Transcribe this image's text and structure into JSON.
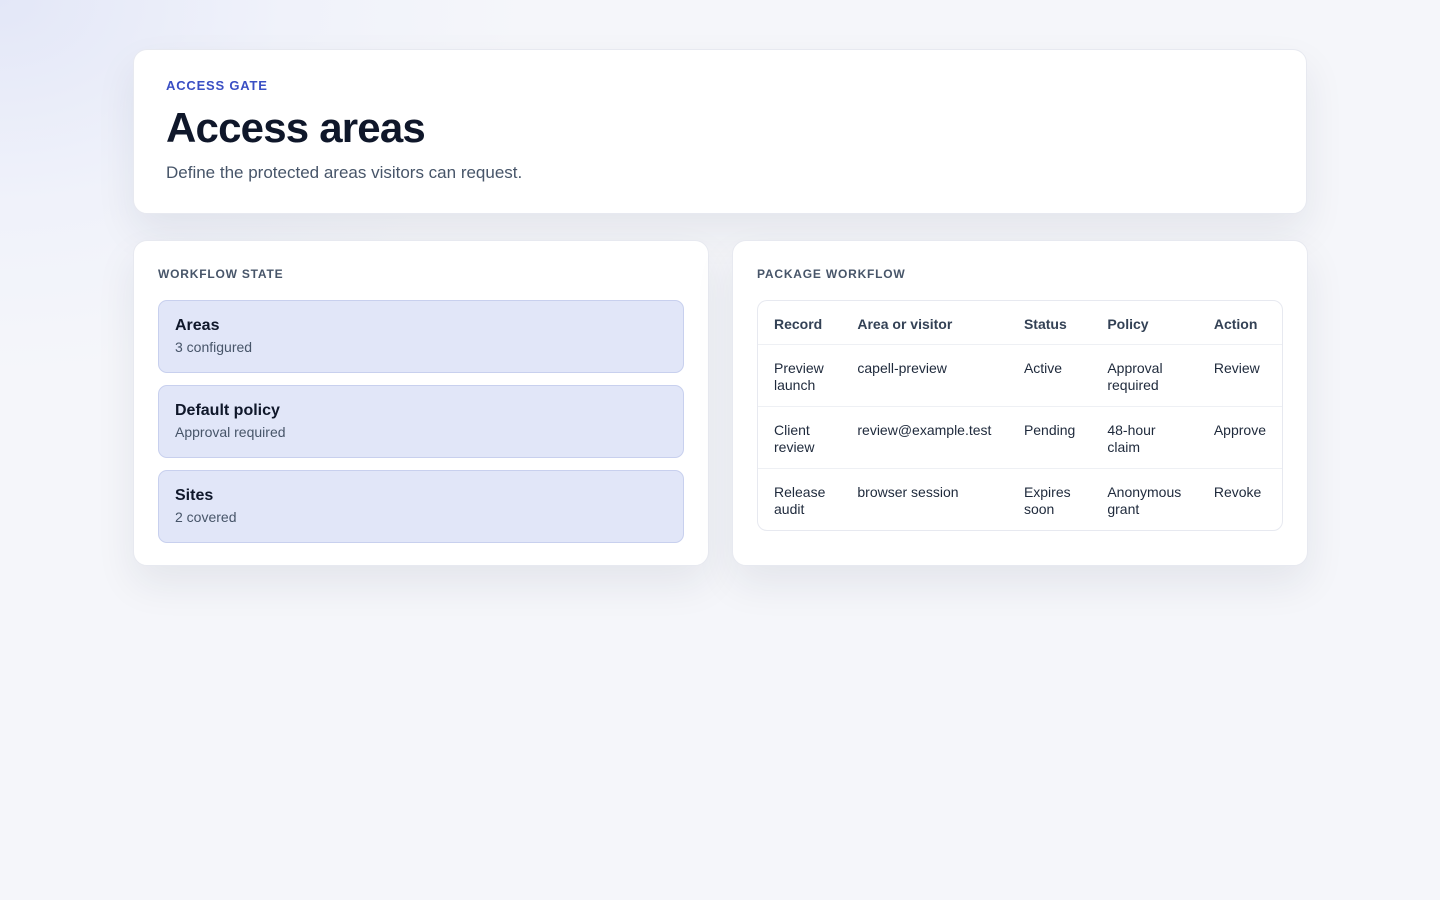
{
  "header": {
    "eyebrow": "ACCESS GATE",
    "title": "Access areas",
    "subtitle": "Define the protected areas visitors can request."
  },
  "workflow_state": {
    "heading": "WORKFLOW STATE",
    "items": [
      {
        "title": "Areas",
        "sub": "3 configured"
      },
      {
        "title": "Default policy",
        "sub": "Approval required"
      },
      {
        "title": "Sites",
        "sub": "2 covered"
      }
    ]
  },
  "package_workflow": {
    "heading": "PACKAGE WORKFLOW",
    "columns": [
      "Record",
      "Area or visitor",
      "Status",
      "Policy",
      "Action"
    ],
    "rows": [
      [
        "Preview launch",
        "capell-preview",
        "Active",
        "Approval required",
        "Review"
      ],
      [
        "Client review",
        "review@example.test",
        "Pending",
        "48-hour claim",
        "Approve"
      ],
      [
        "Release audit",
        "browser session",
        "Expires soon",
        "Anonymous grant",
        "Revoke"
      ]
    ]
  }
}
